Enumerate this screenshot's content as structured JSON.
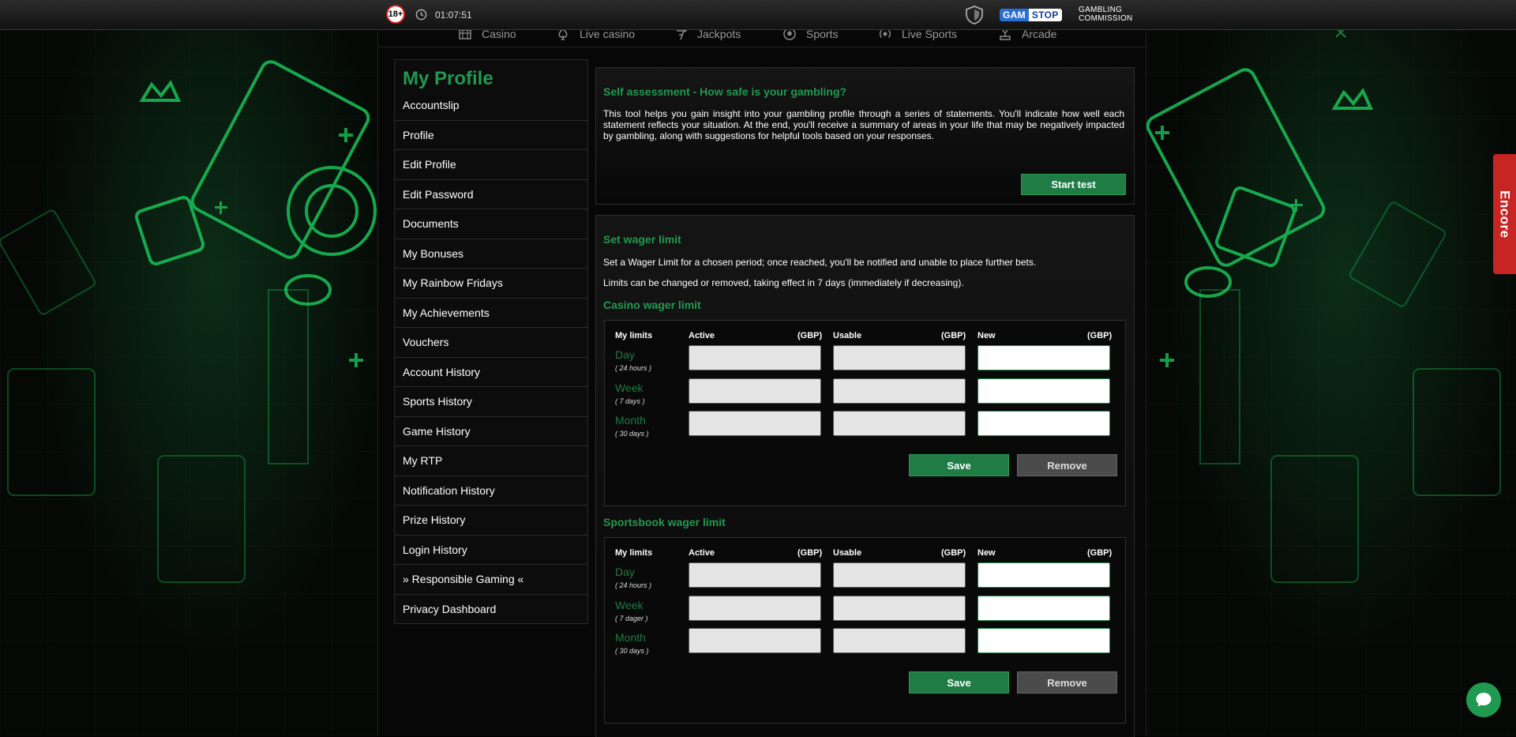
{
  "topbar": {
    "age_badge": "18+",
    "clock": "01:07:51",
    "gamstop_gam": "GAM",
    "gamstop_stop": "STOP",
    "gambling_commission_line1": "GAMBLING",
    "gambling_commission_line2": "COMMISSION"
  },
  "nav": {
    "items": [
      "Casino",
      "Live casino",
      "Jackpots",
      "Sports",
      "Live Sports",
      "Arcade"
    ]
  },
  "sidebar": {
    "title": "My Profile",
    "items": [
      "Accountslip",
      "Profile",
      "Edit Profile",
      "Edit Password",
      "Documents",
      "My Bonuses",
      "My Rainbow Fridays",
      "My Achievements",
      "Vouchers",
      "Account History",
      "Sports History",
      "Game History",
      "My RTP",
      "Notification History",
      "Prize History",
      "Login History",
      "» Responsible Gaming «",
      "Privacy Dashboard"
    ]
  },
  "self_assessment": {
    "title": "Self assessment - How safe is your gambling?",
    "text": "This tool helps you gain insight into your gambling profile through a series of statements. You'll indicate how well each statement reflects your situation. At the end, you'll receive a summary of areas in your life that may be negatively impacted by gambling, along with suggestions for helpful tools based on your responses.",
    "button": "Start test"
  },
  "wager": {
    "title": "Set wager limit",
    "text1": "Set a Wager Limit for a chosen period; once reached, you'll be notified and unable to place further bets.",
    "text2": "Limits can be changed or removed, taking effect in 7 days (immediately if decreasing).",
    "headers": {
      "my_limits": "My limits",
      "active": "Active",
      "usable": "Usable",
      "new": "New",
      "currency": "(GBP)"
    },
    "casino": {
      "title": "Casino wager limit",
      "periods": [
        {
          "name": "Day",
          "sub": "( 24 hours )"
        },
        {
          "name": "Week",
          "sub": "( 7 days )"
        },
        {
          "name": "Month",
          "sub": "( 30 days )"
        }
      ],
      "save": "Save",
      "remove": "Remove"
    },
    "sports": {
      "title": "Sportsbook wager limit",
      "periods": [
        {
          "name": "Day",
          "sub": "( 24 hours )"
        },
        {
          "name": "Week",
          "sub": "( 7 dager )"
        },
        {
          "name": "Month",
          "sub": "( 30 days )"
        }
      ],
      "save": "Save",
      "remove": "Remove"
    }
  },
  "side_tab": "Encore",
  "colors": {
    "accent_green": "#1f9a4f",
    "button_green": "#1f7c45",
    "side_tab_red": "#c72424"
  }
}
